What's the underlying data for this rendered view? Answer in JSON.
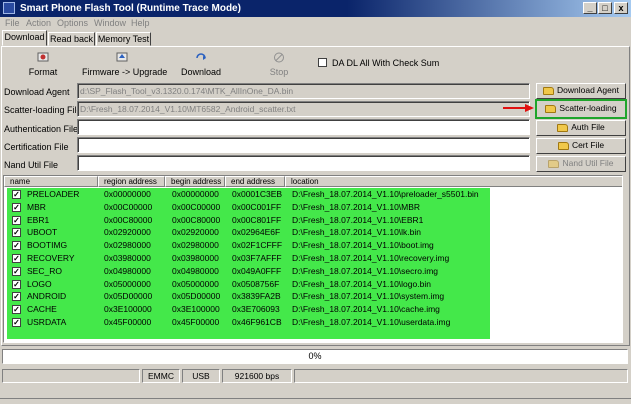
{
  "window": {
    "title": "Smart Phone Flash Tool (Runtime Trace Mode)",
    "controls": {
      "minimize": "_",
      "maximize": "□",
      "close": "x"
    }
  },
  "menu": [
    "File",
    "Action",
    "Options",
    "Window",
    "Help"
  ],
  "tabs": [
    "Download",
    "Read back",
    "Memory Test"
  ],
  "toolbar": {
    "format": "Format",
    "firmware_upgrade": "Firmware -> Upgrade",
    "download": "Download",
    "stop": "Stop",
    "da_checksum": "DA DL All With Check Sum"
  },
  "paths": {
    "download_agent": {
      "label": "Download Agent",
      "value": "d:\\SP_Flash_Tool_v3.1320.0.174\\MTK_AllInOne_DA.bin",
      "button": "Download Agent"
    },
    "scatter": {
      "label": "Scatter-loading File",
      "value": "D:\\Fresh_18.07.2014_V1.10\\MT6582_Android_scatter.txt",
      "button": "Scatter-loading"
    },
    "auth": {
      "label": "Authentication File",
      "value": "",
      "button": "Auth File"
    },
    "cert": {
      "label": "Certification File",
      "value": "",
      "button": "Cert File"
    },
    "nand": {
      "label": "Nand Util File",
      "value": "",
      "button": "Nand Util File"
    }
  },
  "table": {
    "columns": [
      "name",
      "region address",
      "begin address",
      "end address",
      "location"
    ],
    "rows": [
      {
        "name": "PRELOADER",
        "region": "0x00000000",
        "begin": "0x00000000",
        "end": "0x0001C3EB",
        "location": "D:\\Fresh_18.07.2014_V1.10\\preloader_s5501.bin"
      },
      {
        "name": "MBR",
        "region": "0x00C00000",
        "begin": "0x00C00000",
        "end": "0x00C001FF",
        "location": "D:\\Fresh_18.07.2014_V1.10\\MBR"
      },
      {
        "name": "EBR1",
        "region": "0x00C80000",
        "begin": "0x00C80000",
        "end": "0x00C801FF",
        "location": "D:\\Fresh_18.07.2014_V1.10\\EBR1"
      },
      {
        "name": "UBOOT",
        "region": "0x02920000",
        "begin": "0x02920000",
        "end": "0x02964E6F",
        "location": "D:\\Fresh_18.07.2014_V1.10\\lk.bin"
      },
      {
        "name": "BOOTIMG",
        "region": "0x02980000",
        "begin": "0x02980000",
        "end": "0x02F1CFFF",
        "location": "D:\\Fresh_18.07.2014_V1.10\\boot.img"
      },
      {
        "name": "RECOVERY",
        "region": "0x03980000",
        "begin": "0x03980000",
        "end": "0x03F7AFFF",
        "location": "D:\\Fresh_18.07.2014_V1.10\\recovery.img"
      },
      {
        "name": "SEC_RO",
        "region": "0x04980000",
        "begin": "0x04980000",
        "end": "0x049A0FFF",
        "location": "D:\\Fresh_18.07.2014_V1.10\\secro.img"
      },
      {
        "name": "LOGO",
        "region": "0x05000000",
        "begin": "0x05000000",
        "end": "0x0508756F",
        "location": "D:\\Fresh_18.07.2014_V1.10\\logo.bin"
      },
      {
        "name": "ANDROID",
        "region": "0x05D00000",
        "begin": "0x05D00000",
        "end": "0x3839FA2B",
        "location": "D:\\Fresh_18.07.2014_V1.10\\system.img"
      },
      {
        "name": "CACHE",
        "region": "0x3E100000",
        "begin": "0x3E100000",
        "end": "0x3E706093",
        "location": "D:\\Fresh_18.07.2014_V1.10\\cache.img"
      },
      {
        "name": "USRDATA",
        "region": "0x45F00000",
        "begin": "0x45F00000",
        "end": "0x46F961CB",
        "location": "D:\\Fresh_18.07.2014_V1.10\\userdata.img"
      }
    ]
  },
  "progress": {
    "text": "0%",
    "value": 0
  },
  "status": [
    "",
    "EMMC",
    "USB",
    "921600 bps",
    ""
  ],
  "colors": {
    "highlight_rows": "#44e84a",
    "arrow": "#e01010",
    "title_bar": "#0a246a"
  }
}
